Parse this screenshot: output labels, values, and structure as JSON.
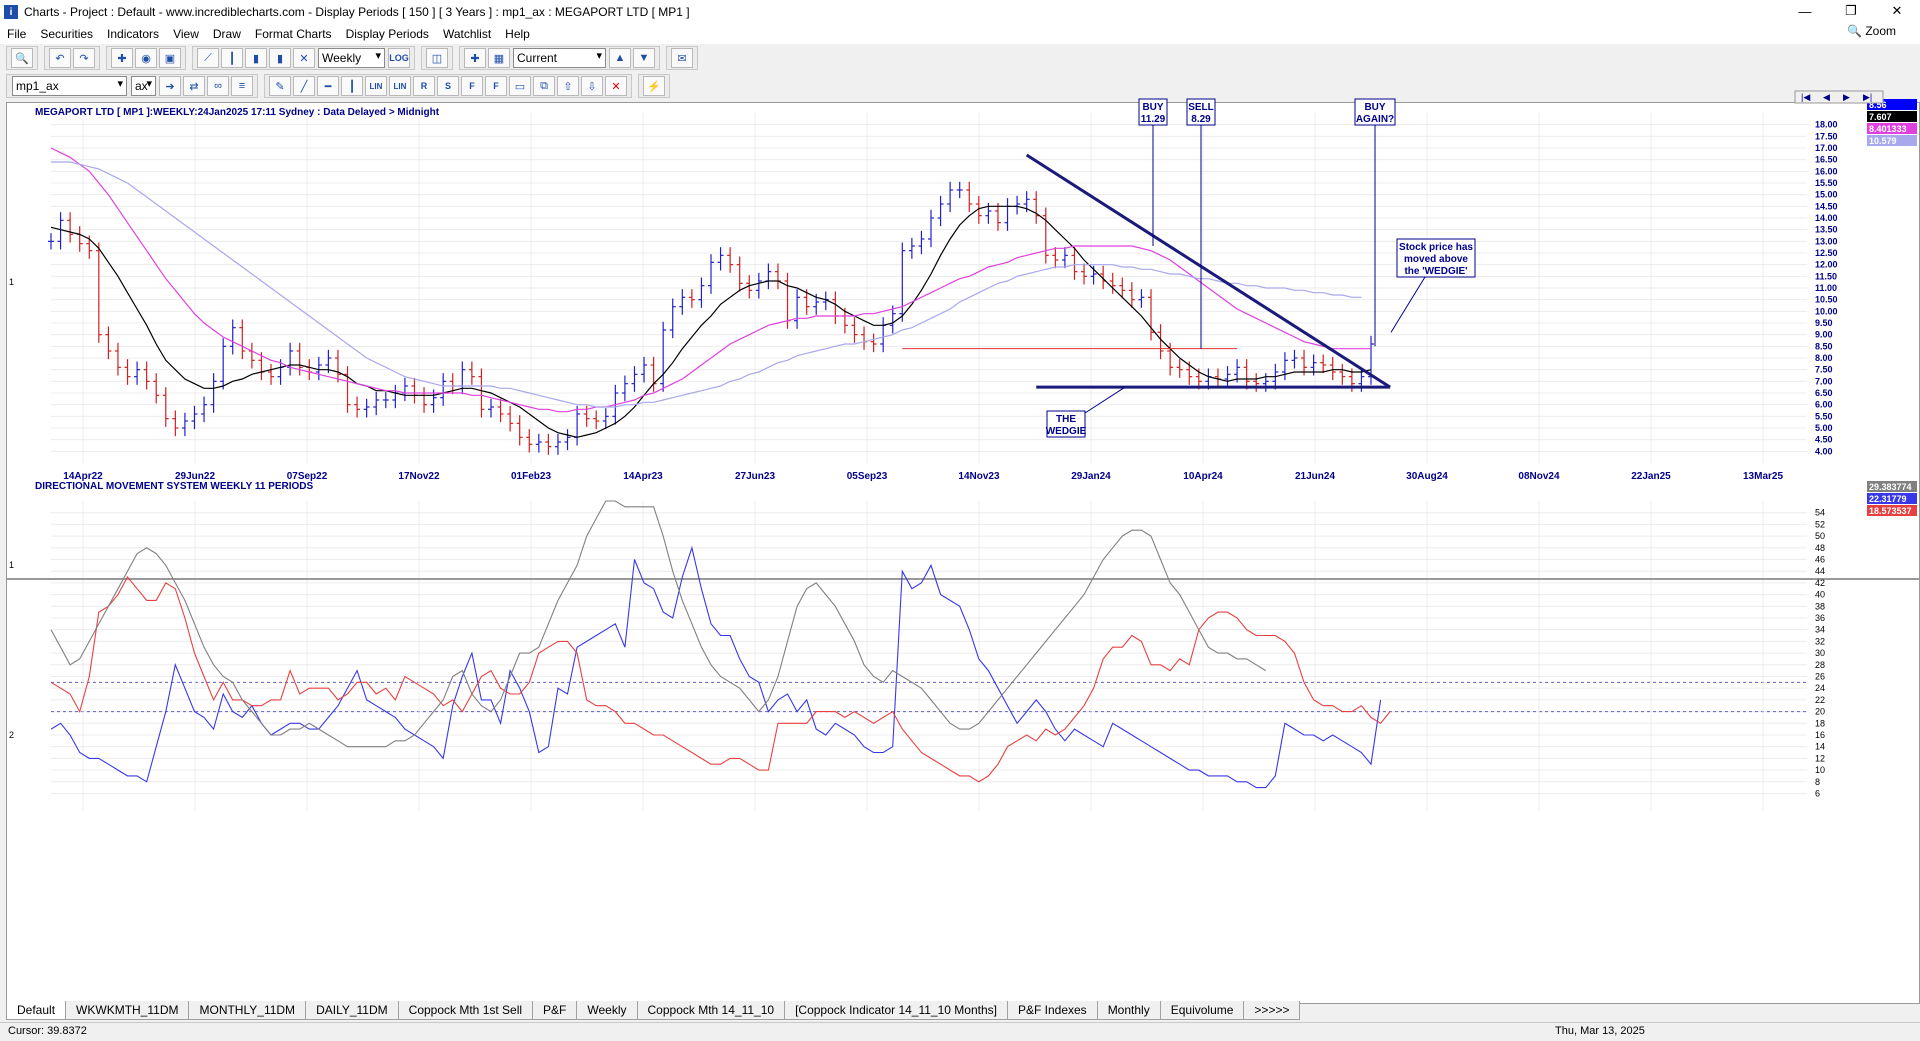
{
  "window": {
    "title": "Charts - Project : Default - www.incrediblecharts.com - Display Periods  [ 150 ]  [ 3 Years ] : mp1_ax : MEGAPORT LTD  [ MP1 ]"
  },
  "menu": [
    "File",
    "Securities",
    "Indicators",
    "View",
    "Draw",
    "Format Charts",
    "Display Periods",
    "Watchlist",
    "Help"
  ],
  "zoom_label": "Zoom",
  "toolbar": {
    "period": "Weekly",
    "log": "LOG",
    "current": "Current",
    "security": "mp1_ax",
    "exchange": "ax",
    "draw_labels": [
      "LIN",
      "LIN",
      "R",
      "S",
      "F",
      "F"
    ]
  },
  "chart_data": [
    {
      "type": "line",
      "title": "MEGAPORT LTD [ MP1 ]:WEEKLY:24Jan2025 17:11 Sydney : Data Delayed > Midnight",
      "left_axis_label": "1",
      "yaxis_ticks": [
        "18.00",
        "17.50",
        "17.00",
        "16.50",
        "16.00",
        "15.50",
        "15.00",
        "14.50",
        "14.00",
        "13.50",
        "13.00",
        "12.50",
        "12.00",
        "11.50",
        "11.00",
        "10.50",
        "10.00",
        "9.50",
        "9.00",
        "8.50",
        "8.00",
        "7.50",
        "7.00",
        "6.50",
        "6.00",
        "5.50",
        "5.00",
        "4.50",
        "4.00"
      ],
      "x_labels": [
        "14Apr22",
        "29Jun22",
        "07Sep22",
        "17Nov22",
        "01Feb23",
        "14Apr23",
        "27Jun23",
        "05Sep23",
        "14Nov23",
        "29Jan24",
        "10Apr24",
        "21Jun24",
        "30Aug24",
        "08Nov24",
        "22Jan25",
        "13Mar25"
      ],
      "price_close": [
        13.0,
        13.9,
        13.3,
        12.9,
        12.6,
        9.0,
        8.3,
        7.6,
        7.2,
        7.5,
        7.0,
        6.4,
        5.4,
        5.0,
        5.3,
        5.6,
        6.0,
        7.0,
        8.5,
        9.3,
        8.3,
        7.9,
        7.4,
        7.2,
        7.6,
        8.3,
        7.6,
        7.4,
        7.7,
        8.0,
        7.3,
        6.0,
        5.8,
        5.9,
        6.2,
        6.2,
        6.5,
        6.8,
        6.4,
        6.0,
        6.3,
        7.0,
        6.8,
        7.5,
        7.2,
        5.8,
        5.9,
        5.6,
        5.2,
        4.6,
        4.3,
        4.4,
        4.2,
        4.4,
        4.6,
        5.6,
        5.4,
        5.3,
        5.5,
        6.5,
        6.9,
        7.3,
        7.7,
        6.9,
        9.2,
        10.2,
        10.6,
        10.5,
        11.1,
        12.1,
        12.4,
        12.0,
        11.2,
        10.9,
        11.3,
        11.7,
        11.3,
        9.6,
        10.6,
        10.2,
        10.4,
        10.5,
        9.8,
        9.4,
        9.0,
        8.7,
        8.6,
        9.4,
        9.9,
        12.6,
        12.8,
        13.1,
        14.0,
        14.6,
        15.2,
        15.2,
        14.6,
        14.1,
        14.3,
        13.8,
        14.5,
        14.6,
        14.8,
        14.1,
        12.4,
        12.2,
        12.4,
        11.7,
        11.5,
        11.6,
        11.3,
        11.1,
        10.9,
        10.5,
        10.6,
        9.1,
        8.3,
        7.6,
        7.5,
        7.2,
        7.0,
        7.2,
        7.1,
        7.3,
        7.6,
        7.0,
        6.9,
        7.0,
        7.4,
        7.9,
        8.0,
        7.6,
        7.8,
        7.7,
        7.4,
        7.2,
        6.9,
        7.2,
        8.6
      ],
      "series": [
        {
          "name": "moving-average-short",
          "color": "#000000",
          "values": [
            13.6,
            13.5,
            13.4,
            13.3,
            13.1,
            12.7,
            12.1,
            11.5,
            10.8,
            10.1,
            9.4,
            8.6,
            7.9,
            7.5,
            7.1,
            6.9,
            6.7,
            6.7,
            6.8,
            7.0,
            7.1,
            7.3,
            7.4,
            7.5,
            7.6,
            7.7,
            7.7,
            7.6,
            7.5,
            7.5,
            7.4,
            7.2,
            6.9,
            6.8,
            6.6,
            6.6,
            6.5,
            6.4,
            6.4,
            6.4,
            6.4,
            6.5,
            6.6,
            6.7,
            6.7,
            6.6,
            6.5,
            6.3,
            6.1,
            5.9,
            5.6,
            5.3,
            5.0,
            4.8,
            4.7,
            4.6,
            4.7,
            4.8,
            5.0,
            5.2,
            5.5,
            5.9,
            6.4,
            6.9,
            7.3,
            7.8,
            8.4,
            8.9,
            9.4,
            9.8,
            10.3,
            10.6,
            10.9,
            11.1,
            11.2,
            11.3,
            11.3,
            11.1,
            11.0,
            10.8,
            10.6,
            10.5,
            10.3,
            10.0,
            9.8,
            9.6,
            9.4,
            9.4,
            9.5,
            9.8,
            10.3,
            10.9,
            11.6,
            12.4,
            13.1,
            13.7,
            14.1,
            14.4,
            14.5,
            14.5,
            14.5,
            14.5,
            14.4,
            14.2,
            13.9,
            13.5,
            13.1,
            12.7,
            12.2,
            11.8,
            11.4,
            11.0,
            10.6,
            10.2,
            9.8,
            9.3,
            8.8,
            8.4,
            8.0,
            7.7,
            7.4,
            7.2,
            7.1,
            7.0,
            7.1,
            7.1,
            7.1,
            7.2,
            7.2,
            7.3,
            7.4,
            7.4,
            7.4,
            7.4,
            7.5,
            7.5,
            7.4,
            7.4,
            7.5
          ]
        },
        {
          "name": "moving-average-medium",
          "color": "#e040e0",
          "values": [
            17.0,
            16.8,
            16.6,
            16.3,
            16.0,
            15.5,
            15.0,
            14.4,
            13.8,
            13.2,
            12.6,
            12.0,
            11.4,
            10.9,
            10.4,
            9.9,
            9.5,
            9.2,
            8.9,
            8.7,
            8.5,
            8.3,
            8.1,
            7.9,
            7.8,
            7.6,
            7.5,
            7.4,
            7.3,
            7.2,
            7.1,
            7.0,
            6.9,
            6.8,
            6.7,
            6.6,
            6.6,
            6.5,
            6.5,
            6.5,
            6.5,
            6.5,
            6.5,
            6.5,
            6.4,
            6.4,
            6.3,
            6.2,
            6.1,
            6.0,
            5.9,
            5.8,
            5.8,
            5.7,
            5.7,
            5.8,
            5.8,
            5.9,
            5.9,
            6.0,
            6.1,
            6.2,
            6.4,
            6.5,
            6.7,
            6.9,
            7.1,
            7.4,
            7.7,
            8.0,
            8.3,
            8.6,
            8.8,
            9.0,
            9.2,
            9.4,
            9.5,
            9.6,
            9.7,
            9.7,
            9.8,
            9.8,
            9.8,
            9.8,
            9.8,
            9.9,
            9.9,
            10.0,
            10.1,
            10.2,
            10.4,
            10.6,
            10.8,
            11.0,
            11.2,
            11.4,
            11.5,
            11.7,
            11.9,
            12.0,
            12.1,
            12.3,
            12.4,
            12.5,
            12.6,
            12.7,
            12.7,
            12.8,
            12.8,
            12.8,
            12.8,
            12.8,
            12.8,
            12.8,
            12.7,
            12.6,
            12.4,
            12.2,
            11.9,
            11.6,
            11.3,
            11.0,
            10.7,
            10.4,
            10.1,
            9.9,
            9.7,
            9.5,
            9.3,
            9.1,
            8.9,
            8.7,
            8.6,
            8.5,
            8.4,
            8.4,
            8.4,
            8.4,
            8.4
          ]
        },
        {
          "name": "moving-average-long",
          "color": "#a8a8ec",
          "values": [
            16.4,
            16.4,
            16.4,
            16.3,
            16.2,
            16.1,
            15.9,
            15.7,
            15.5,
            15.2,
            14.9,
            14.6,
            14.3,
            14.0,
            13.7,
            13.4,
            13.1,
            12.8,
            12.5,
            12.2,
            11.9,
            11.6,
            11.3,
            11.0,
            10.7,
            10.4,
            10.1,
            9.8,
            9.5,
            9.2,
            8.9,
            8.6,
            8.3,
            8.0,
            7.8,
            7.6,
            7.4,
            7.2,
            7.1,
            7.0,
            6.9,
            6.8,
            6.8,
            6.8,
            6.8,
            6.8,
            6.8,
            6.7,
            6.7,
            6.6,
            6.5,
            6.4,
            6.3,
            6.2,
            6.1,
            6.0,
            6.0,
            5.9,
            5.9,
            5.9,
            6.0,
            6.0,
            6.1,
            6.1,
            6.2,
            6.3,
            6.4,
            6.5,
            6.6,
            6.7,
            6.8,
            7.0,
            7.1,
            7.3,
            7.4,
            7.6,
            7.8,
            7.9,
            8.1,
            8.2,
            8.3,
            8.4,
            8.5,
            8.6,
            8.6,
            8.7,
            8.8,
            8.9,
            9.0,
            9.2,
            9.3,
            9.5,
            9.7,
            9.9,
            10.1,
            10.4,
            10.6,
            10.8,
            11.0,
            11.2,
            11.3,
            11.5,
            11.6,
            11.7,
            11.8,
            11.9,
            11.9,
            12.0,
            12.0,
            12.0,
            12.0,
            12.0,
            11.9,
            11.9,
            11.8,
            11.8,
            11.7,
            11.6,
            11.6,
            11.5,
            11.4,
            11.4,
            11.3,
            11.2,
            11.2,
            11.1,
            11.1,
            11.0,
            11.0,
            11.0,
            10.9,
            10.9,
            10.8,
            10.8,
            10.7,
            10.7,
            10.6,
            10.6
          ]
        }
      ],
      "value_boxes": [
        {
          "value": "8.56",
          "color": "#0000ff"
        },
        {
          "value": "7.607",
          "color": "#000000"
        },
        {
          "value": "8.401333",
          "color": "#e040e0"
        },
        {
          "value": "10.579",
          "color": "#a8a8ec"
        }
      ],
      "annotations": {
        "buy": "BUY\n11.29",
        "sell": "SELL\n8.29",
        "buy_again": "BUY\nAGAIN?",
        "wedgie": "THE\nWEDGIE",
        "stock_note": "Stock price has\nmoved above\nthe 'WEDGIE'"
      }
    },
    {
      "type": "line",
      "title": "DIRECTIONAL MOVEMENT SYSTEM WEEKLY 11 PERIODS",
      "left_axis_labels": [
        "1",
        "2"
      ],
      "yaxis_ticks": [
        "54",
        "52",
        "50",
        "48",
        "46",
        "44",
        "42",
        "40",
        "38",
        "36",
        "34",
        "32",
        "30",
        "28",
        "26",
        "24",
        "22",
        "20",
        "18",
        "16",
        "14",
        "12",
        "10",
        "8",
        "6"
      ],
      "series": [
        {
          "name": "plus-di",
          "color": "#3838e8",
          "values": [
            17,
            18,
            16,
            13,
            12,
            12,
            11,
            10,
            9,
            9,
            8,
            14,
            20,
            28,
            24,
            20,
            19,
            17,
            23,
            20,
            19,
            21,
            18,
            16,
            17,
            18,
            18,
            17,
            17,
            19,
            21,
            24,
            27,
            22,
            21,
            20,
            19,
            17,
            16,
            15,
            14,
            12,
            21,
            26,
            30,
            22,
            22,
            18,
            27,
            24,
            20,
            13,
            14,
            24,
            23,
            31,
            32,
            33,
            34,
            35,
            31,
            46,
            42,
            41,
            37,
            36,
            43,
            48,
            41,
            35,
            33,
            33,
            29,
            26,
            25,
            20,
            22,
            23,
            20,
            22,
            17,
            16,
            18,
            17,
            16,
            14,
            13,
            13,
            14,
            44,
            41,
            42,
            45,
            40,
            39,
            38,
            34,
            29,
            27,
            24,
            21,
            18,
            20,
            22,
            20,
            17,
            15,
            17,
            16,
            15,
            14,
            18,
            17,
            16,
            15,
            14,
            13,
            12,
            11,
            10,
            10,
            9,
            9,
            9,
            8,
            8,
            7,
            7,
            9,
            18,
            17,
            16,
            16,
            15,
            16,
            15,
            14,
            13,
            11,
            22
          ]
        },
        {
          "name": "minus-di",
          "color": "#e84040",
          "values": [
            25,
            24,
            23,
            20,
            26,
            37,
            38,
            40,
            43,
            41,
            39,
            39,
            42,
            41,
            36,
            30,
            26,
            22,
            25,
            22,
            22,
            21,
            21,
            22,
            22,
            27,
            23,
            24,
            24,
            24,
            22,
            23,
            25,
            25,
            23,
            24,
            22,
            26,
            25,
            24,
            23,
            21,
            22,
            20,
            23,
            26,
            27,
            24,
            23,
            23,
            25,
            30,
            31,
            32,
            32,
            30,
            22,
            21,
            21,
            20,
            18,
            18,
            17,
            16,
            16,
            15,
            14,
            13,
            12,
            11,
            11,
            12,
            12,
            11,
            10,
            10,
            18,
            18,
            18,
            18,
            20,
            20,
            20,
            19,
            20,
            19,
            18,
            19,
            20,
            17,
            15,
            13,
            12,
            11,
            10,
            9,
            9,
            8,
            9,
            11,
            14,
            15,
            16,
            15,
            17,
            16,
            17,
            19,
            21,
            24,
            29,
            31,
            31,
            33,
            32,
            28,
            28,
            27,
            29,
            28,
            34,
            36,
            37,
            37,
            36,
            34,
            33,
            33,
            33,
            32,
            30,
            25,
            22,
            21,
            21,
            20,
            20,
            21,
            19,
            18,
            20
          ]
        },
        {
          "name": "adx",
          "color": "#808080",
          "values": [
            34,
            31,
            28,
            29,
            32,
            35,
            38,
            41,
            44,
            47,
            48,
            47,
            45,
            42,
            39,
            35,
            31,
            28,
            26,
            25,
            22,
            20,
            18,
            16,
            16,
            17,
            17,
            18,
            17,
            16,
            15,
            14,
            14,
            14,
            14,
            14,
            15,
            15,
            16,
            18,
            20,
            22,
            26,
            27,
            23,
            21,
            20,
            22,
            26,
            30,
            30,
            31,
            35,
            39,
            42,
            45,
            50,
            53,
            56,
            56,
            55,
            55,
            55,
            55,
            50,
            44,
            39,
            35,
            31,
            28,
            26,
            25,
            24,
            22,
            20,
            22,
            26,
            32,
            38,
            41,
            42,
            40,
            38,
            35,
            32,
            28,
            26,
            25,
            27,
            26,
            25,
            24,
            22,
            20,
            18,
            17,
            17,
            18,
            20,
            22,
            24,
            26,
            28,
            30,
            32,
            34,
            36,
            38,
            40,
            43,
            46,
            48,
            50,
            51,
            51,
            50,
            46,
            42,
            40,
            37,
            34,
            31,
            30,
            30,
            29,
            29,
            28,
            27
          ]
        }
      ],
      "value_boxes": [
        {
          "value": "29.383774",
          "color": "#808080"
        },
        {
          "value": "22.31779",
          "color": "#3838e8"
        },
        {
          "value": "18.573537",
          "color": "#e84040"
        }
      ]
    }
  ],
  "tabs": [
    "Default",
    "WKWKMTH_11DM",
    "MONTHLY_11DM",
    "DAILY_11DM",
    "Coppock Mth 1st Sell",
    "P&F",
    "Weekly",
    "Coppock Mth 14_11_10",
    "[Coppock Indicator 14_11_10 Months]",
    "P&F Indexes",
    "Monthly",
    "Equivolume",
    ">>>>>"
  ],
  "status": {
    "cursor": "Cursor: 39.8372",
    "date": "Thu, Mar 13, 2025"
  }
}
